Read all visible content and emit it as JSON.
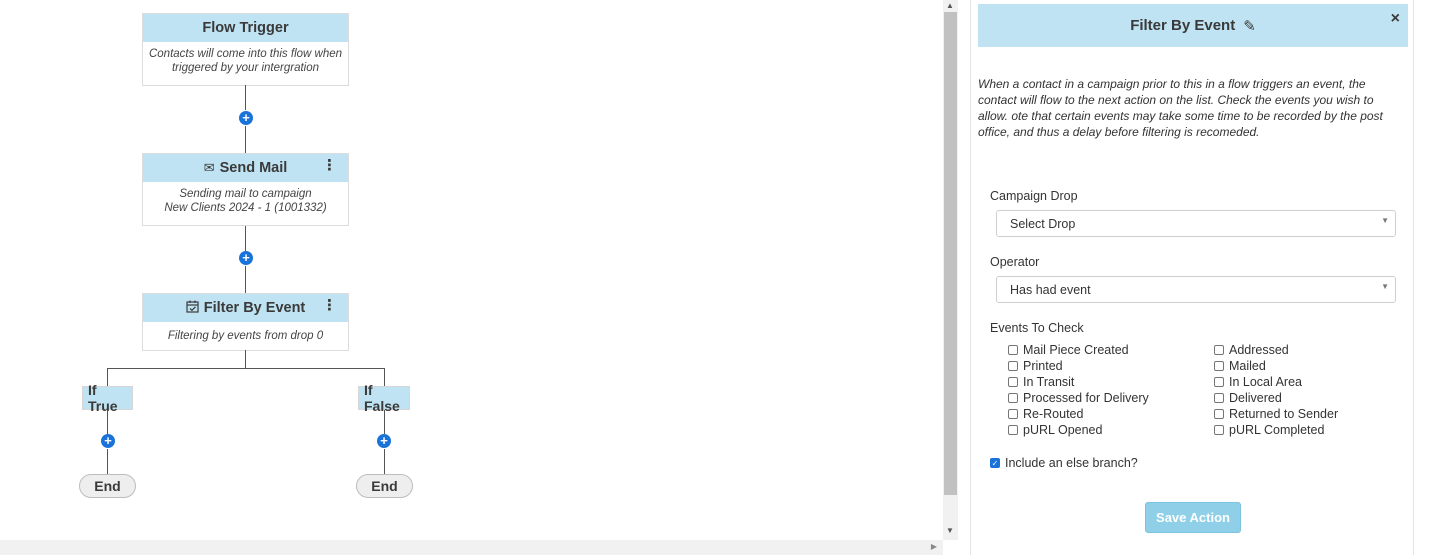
{
  "flow": {
    "trigger": {
      "title": "Flow Trigger",
      "body": "Contacts will come into this flow when triggered by your intergration"
    },
    "send_mail": {
      "title": "Send Mail",
      "icon": "envelope-icon",
      "body_line1": "Sending mail to campaign",
      "body_line2": "New Clients 2024 - 1 (1001332)",
      "menu": "⋮"
    },
    "filter": {
      "title": "Filter By Event",
      "icon": "calendar-check-icon",
      "body": "Filtering by events from drop 0",
      "menu": "⋮"
    },
    "add_symbol": "+",
    "branch_true": "If True",
    "branch_false": "If False",
    "end_true": "End",
    "end_false": "End"
  },
  "panel": {
    "title": "Filter By Event",
    "edit_icon": "✎",
    "close_icon": "×",
    "description": "When a contact in a campaign prior to this in a flow triggers an event, the contact will flow to the next action on the list. Check the events you wish to allow. ote that certain events may take some time to be recorded by the post office, and thus a delay before filtering is recomeded.",
    "campaign_drop_label": "Campaign Drop",
    "campaign_drop_value": "Select Drop",
    "operator_label": "Operator",
    "operator_value": "Has had event",
    "events_label": "Events To Check",
    "events_left": [
      "Mail Piece Created",
      "Printed",
      "In Transit",
      "Processed for Delivery",
      "Re-Routed",
      "pURL Opened"
    ],
    "events_right": [
      "Addressed",
      "Mailed",
      "In Local Area",
      "Delivered",
      "Returned to Sender",
      "pURL Completed"
    ],
    "else_branch_label": "Include an else branch?",
    "else_branch_checked": true,
    "save_label": "Save Action"
  },
  "colors": {
    "node_header": "#bfe3f3",
    "plus": "#1a73d9",
    "save_button": "#8fd0e8"
  }
}
